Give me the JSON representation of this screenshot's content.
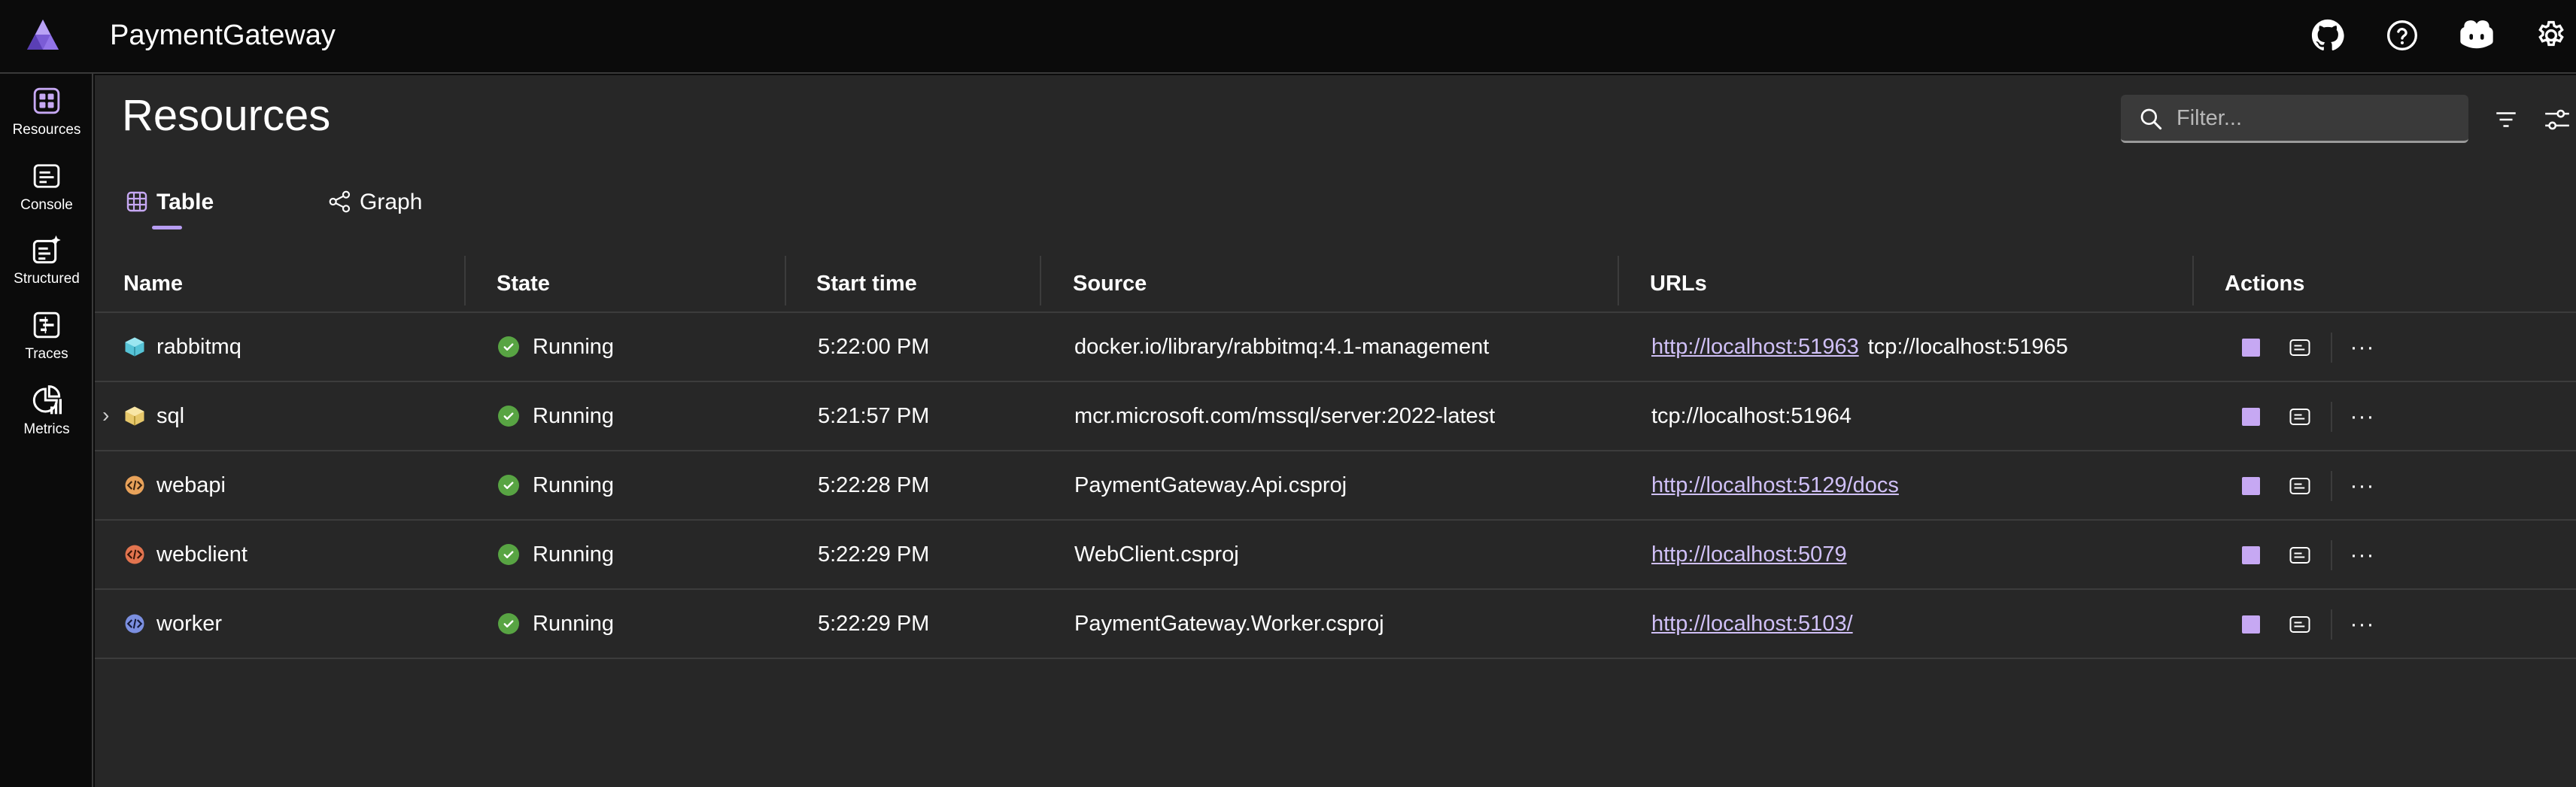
{
  "app": {
    "title": "PaymentGateway"
  },
  "topbar": {
    "icons": [
      "github-icon",
      "help-icon",
      "copilot-icon",
      "settings-icon"
    ]
  },
  "sidenav": {
    "items": [
      {
        "label": "Resources",
        "icon": "resources-icon"
      },
      {
        "label": "Console",
        "icon": "console-icon"
      },
      {
        "label": "Structured",
        "icon": "structured-logs-icon"
      },
      {
        "label": "Traces",
        "icon": "traces-icon"
      },
      {
        "label": "Metrics",
        "icon": "metrics-icon"
      }
    ]
  },
  "page": {
    "title": "Resources",
    "filter_placeholder": "Filter...",
    "tabs": [
      {
        "label": "Table",
        "icon": "table-icon",
        "active": true
      },
      {
        "label": "Graph",
        "icon": "graph-icon",
        "active": false
      }
    ]
  },
  "grid": {
    "columns": [
      "Name",
      "State",
      "Start time",
      "Source",
      "URLs",
      "Actions"
    ],
    "rows": [
      {
        "name": "rabbitmq",
        "icon": "container-icon",
        "state": "Running",
        "start_time": "5:22:00 PM",
        "source": "docker.io/library/rabbitmq:4.1-management",
        "url_link": "http://localhost:51963",
        "url_text": "tcp://localhost:51965",
        "expandable": false
      },
      {
        "name": "sql",
        "icon": "container-icon",
        "state": "Running",
        "start_time": "5:21:57 PM",
        "source": "mcr.microsoft.com/mssql/server:2022-latest",
        "url_link": "",
        "url_text": "tcp://localhost:51964",
        "expandable": true
      },
      {
        "name": "webapi",
        "icon": "project-icon",
        "state": "Running",
        "start_time": "5:22:28 PM",
        "source": "PaymentGateway.Api.csproj",
        "url_link": "http://localhost:5129/docs",
        "url_text": "",
        "expandable": false
      },
      {
        "name": "webclient",
        "icon": "project-icon",
        "state": "Running",
        "start_time": "5:22:29 PM",
        "source": "WebClient.csproj",
        "url_link": "http://localhost:5079",
        "url_text": "",
        "expandable": false
      },
      {
        "name": "worker",
        "icon": "project-icon",
        "state": "Running",
        "start_time": "5:22:29 PM",
        "source": "PaymentGateway.Worker.csproj",
        "url_link": "http://localhost:5103/",
        "url_text": "",
        "expandable": false
      }
    ]
  },
  "colors": {
    "accent": "#b79df2",
    "running": "#58a443",
    "link": "#d0c0f7",
    "background": "#272727"
  }
}
